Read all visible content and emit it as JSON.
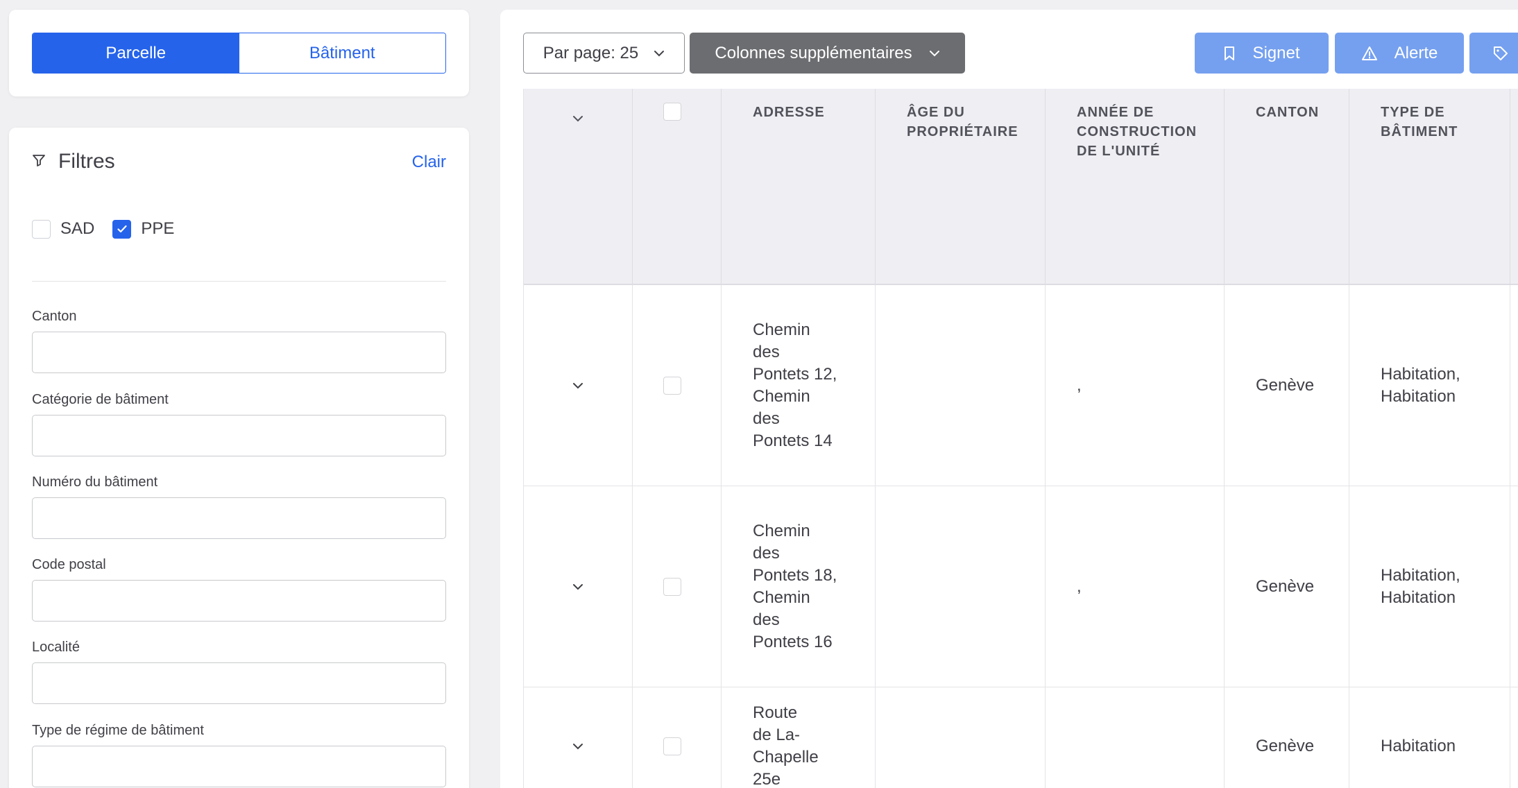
{
  "mode_toggle": {
    "active": "Parcelle",
    "inactive": "Bâtiment"
  },
  "filters": {
    "title": "Filtres",
    "clear": "Clair",
    "checkboxes": [
      {
        "label": "SAD",
        "checked": false
      },
      {
        "label": "PPE",
        "checked": true
      }
    ],
    "fields": [
      {
        "label": "Canton",
        "value": ""
      },
      {
        "label": "Catégorie de bâtiment",
        "value": ""
      },
      {
        "label": "Numéro du bâtiment",
        "value": ""
      },
      {
        "label": "Code postal",
        "value": ""
      },
      {
        "label": "Localité",
        "value": ""
      },
      {
        "label": "Type de régime de bâtiment",
        "value": ""
      }
    ]
  },
  "toolbar": {
    "per_page": "Par page: 25",
    "extra_columns": "Colonnes supplémentaires",
    "bookmark": "Signet",
    "alert": "Alerte"
  },
  "table": {
    "columns": [
      "ADRESSE",
      "ÂGE DU PROPRIÉTAIRE",
      "ANNÉE DE CONSTRUCTION DE L'UNITÉ",
      "CANTON",
      "TYPE DE BÂTIMENT"
    ],
    "rows": [
      {
        "address": "Chemin des Pontets 12, Chemin des Pontets 14",
        "owner_age": "",
        "year": ",",
        "canton": "Genève",
        "type": "Habitation, Habitation"
      },
      {
        "address": "Chemin des Pontets 18, Chemin des Pontets 16",
        "owner_age": "",
        "year": ",",
        "canton": "Genève",
        "type": "Habitation, Habitation"
      },
      {
        "address": "Route de La-Chapelle 25e",
        "owner_age": "",
        "year": "",
        "canton": "Genève",
        "type": "Habitation"
      }
    ]
  },
  "colors": {
    "primary": "#2563eb",
    "primary_light": "#75a0ef",
    "secondary": "#6c6d70",
    "header_bg": "#eeeef3"
  },
  "icons": [
    "filter-icon",
    "check-icon",
    "chevron-down-icon",
    "bookmark-icon",
    "alert-triangle-icon",
    "tag-icon"
  ]
}
